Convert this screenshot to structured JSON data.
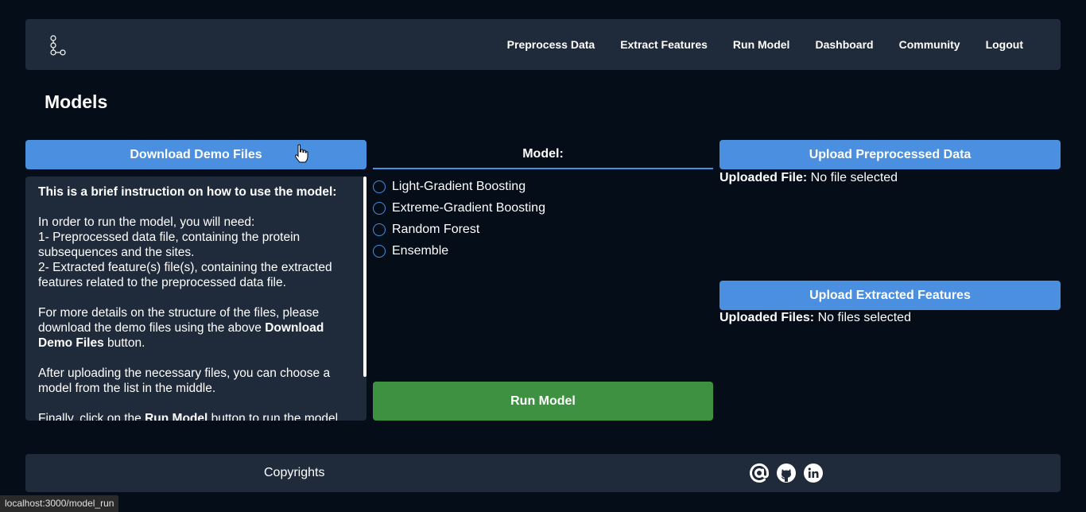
{
  "nav": {
    "logo": "graph-logo-icon",
    "links": [
      "Preprocess Data",
      "Extract Features",
      "Run Model",
      "Dashboard",
      "Community",
      "Logout"
    ]
  },
  "page": {
    "title": "Models"
  },
  "left": {
    "download_label": "Download Demo Files",
    "instructions": {
      "heading": "This is a brief instruction on how to use the model:",
      "need": "In order to run the model, you will need:",
      "item1": "1- Preprocessed data file, containing the protein subsequences and the sites.",
      "item2": "2- Extracted feature(s) file(s), containing the extracted features related to the preprocessed data file.",
      "details_pre": "For more details on the structure of the files, please download the demo files using the above ",
      "details_bold": "Download Demo Files",
      "details_post": " button.",
      "after": "After uploading the necessary files, you can choose a model from the list in the middle.",
      "final_pre": "Finally, click on the ",
      "final_bold": "Run Model",
      "final_post": " button to run the model"
    }
  },
  "middle": {
    "header": "Model:",
    "models": [
      "Light-Gradient Boosting",
      "Extreme-Gradient Boosting",
      "Random Forest",
      "Ensemble"
    ],
    "run_label": "Run Model"
  },
  "right": {
    "upload_pre_label": "Upload Preprocessed Data",
    "uploaded_pre_key": "Uploaded File:",
    "uploaded_pre_value": " No file selected",
    "upload_feat_label": "Upload Extracted Features",
    "uploaded_feat_key": "Uploaded Files:",
    "uploaded_feat_value": " No files selected"
  },
  "footer": {
    "copyright": "Copyrights",
    "social": [
      "at-sign-icon",
      "github-icon",
      "linkedin-icon"
    ]
  },
  "status_url": "localhost:3000/model_run",
  "colors": {
    "background": "#040d18",
    "panel": "#1f2a3a",
    "accent_blue": "#4a8fe0",
    "run_green": "#3f9142"
  }
}
